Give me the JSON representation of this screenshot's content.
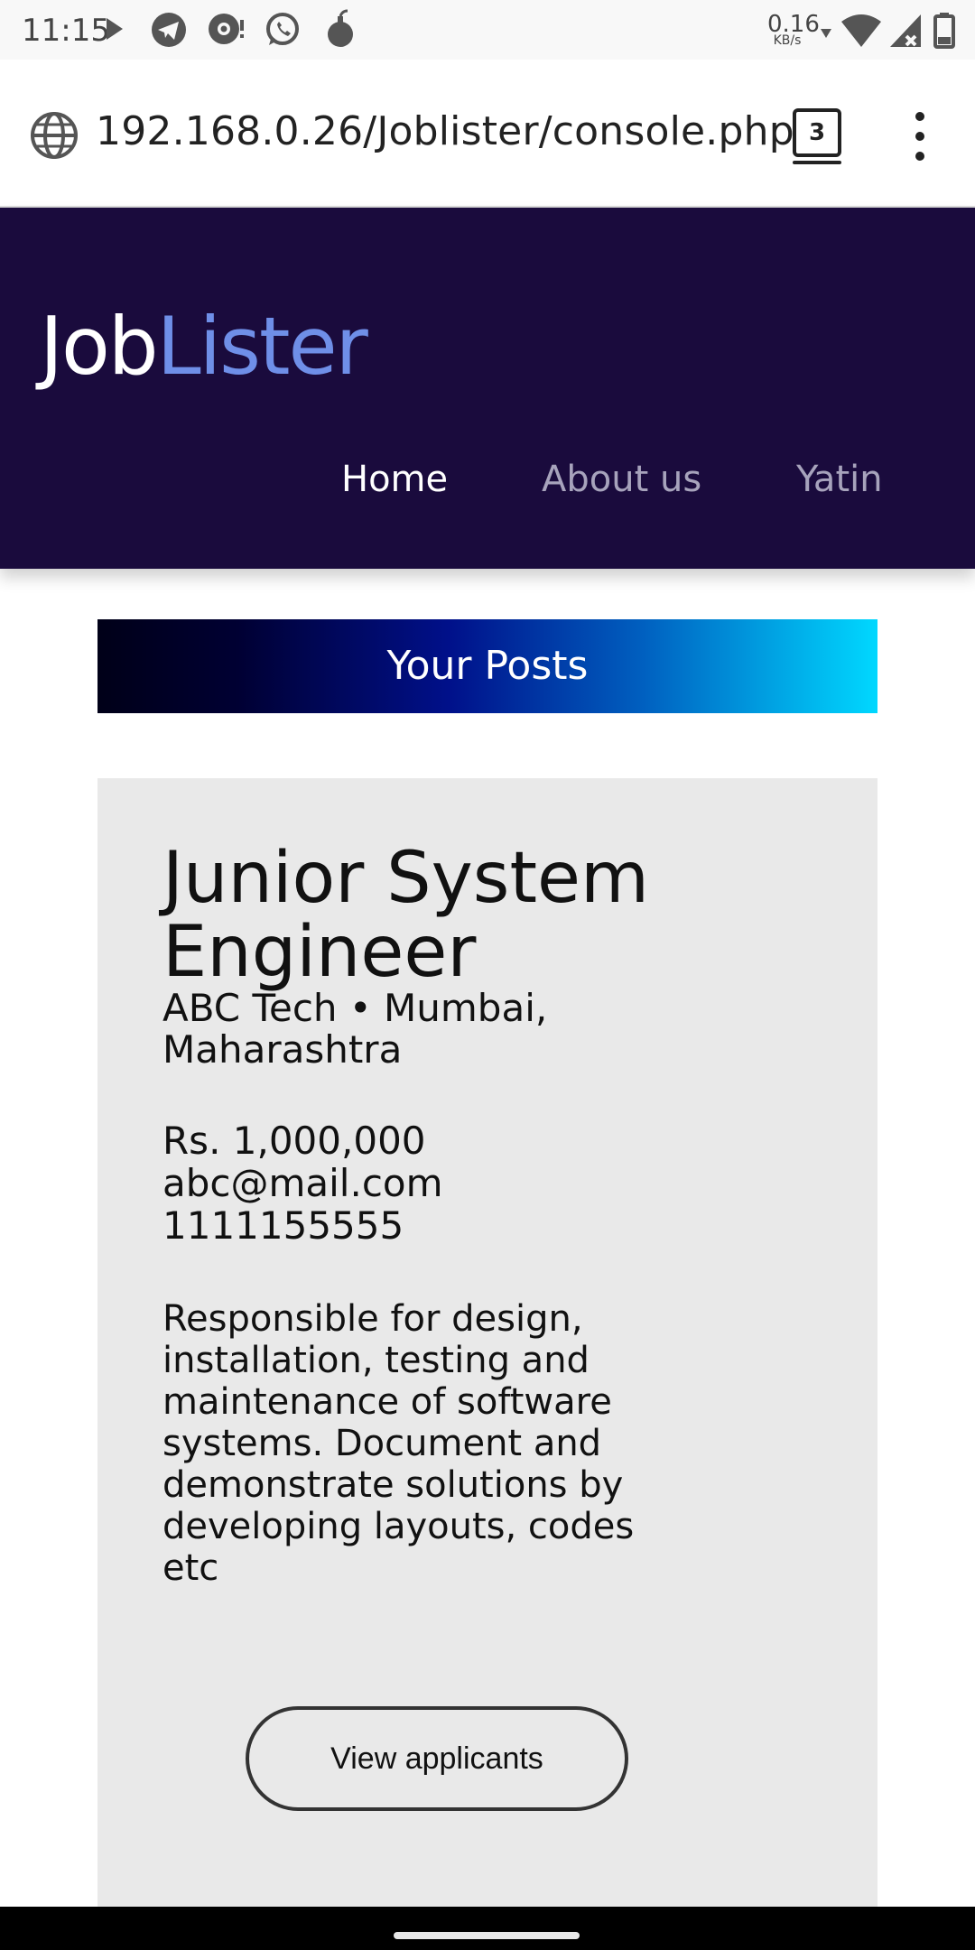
{
  "status_bar": {
    "time": "11:15",
    "net_speed_value": "0.16",
    "net_speed_unit": "KB/s",
    "icons": [
      "play-icon",
      "telegram-icon",
      "chat-icon",
      "whatsapp-icon",
      "bomb-icon",
      "wifi-icon",
      "signal-icon",
      "battery-icon"
    ]
  },
  "browser": {
    "url": "192.168.0.26/Joblister/console.php",
    "tab_count": "3"
  },
  "site": {
    "logo_part1": "Job",
    "logo_part2": "Lister",
    "nav": {
      "home": "Home",
      "about": "About us",
      "user": "Yatin"
    },
    "colors": {
      "header_bg": "#1a0b3d",
      "logo_accent": "#6f8fe8"
    }
  },
  "posts": {
    "banner": "Your Posts",
    "job": {
      "title": "Junior System Engineer",
      "company_location": "ABC Tech • Mumbai, Maharashtra",
      "salary": "Rs. 1,000,000",
      "email": "abc@mail.com",
      "phone": "1111155555",
      "description": "Responsible for design, installation, testing and maintenance of software systems. Document and demonstrate solutions by developing layouts, codes etc",
      "button": "View applicants"
    }
  }
}
